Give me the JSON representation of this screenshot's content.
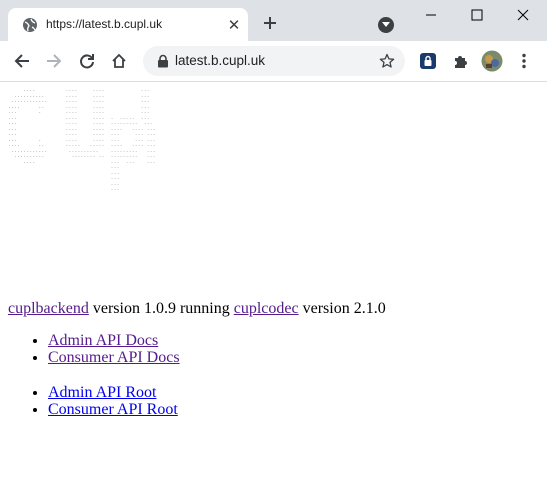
{
  "browser": {
    "tab_title": "https://latest.b.cupl.uk",
    "url": "latest.b.cupl.uk",
    "favicon": "globe-icon"
  },
  "page": {
    "logo_art": "     ....          ....     ....            ...\n  ..........       ....     ....            ...\n ............      ....     ....            ...\n....      ..       ....     ....            ...\n...       .        ....     ....            ...\n...                ....     ....  .  .....  ...\n...                ....     ....  .........  ...\n...                ....     ....  ....   .... ...\n...                ....     ....  ...     ... ...\n...       .        ....     ....  ...     ... ...\n....      ..       .....   .....  ....   .... ...\n ............       ..........    .........   ...\n  ..........         ........ ..  .........   ...\n     ....                         ...  ...    ...\n                                  ...\n                                  ...\n                                  ...\n                                  ...\n                                  ...",
    "version_line": {
      "link1": "cuplbackend",
      "text1": "version 1.0.9 running",
      "link2": "cuplcodec",
      "text2": "version 2.1.0"
    },
    "docs_links": [
      "Admin API Docs",
      "Consumer API Docs"
    ],
    "root_links": [
      "Admin API Root",
      "Consumer API Root"
    ]
  },
  "colors": {
    "visited_link": "#551a8b",
    "link": "#0000ee",
    "tabstrip": "#dee1e6"
  }
}
